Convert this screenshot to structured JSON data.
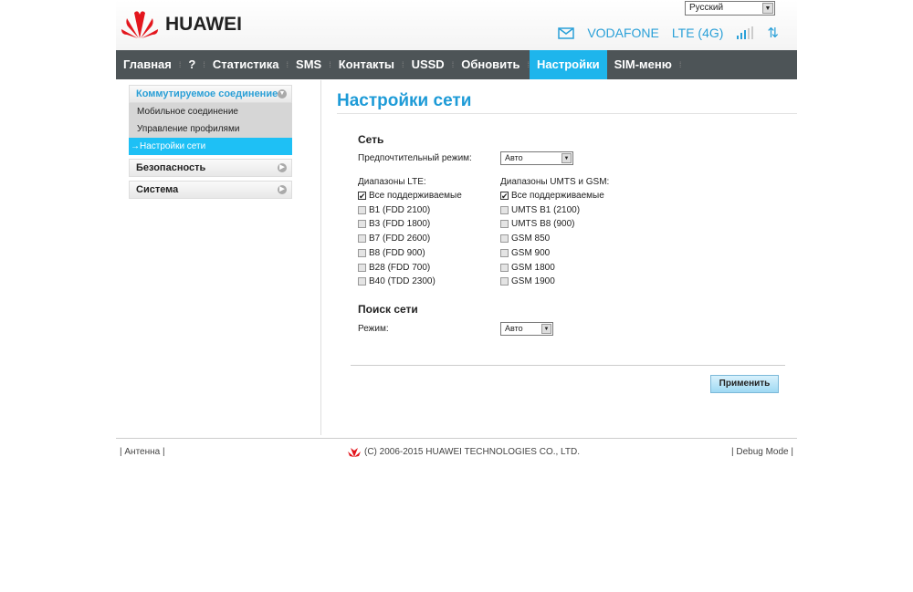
{
  "header": {
    "brand": "HUAWEI",
    "language": "Русский",
    "operator": "VODAFONE",
    "network": "LTE (4G)"
  },
  "nav": [
    {
      "label": "Главная"
    },
    {
      "label": "?"
    },
    {
      "label": "Статистика"
    },
    {
      "label": "SMS"
    },
    {
      "label": "Контакты"
    },
    {
      "label": "USSD"
    },
    {
      "label": "Обновить"
    },
    {
      "label": "Настройки",
      "active": true
    },
    {
      "label": "SIM-меню"
    }
  ],
  "sidebar": {
    "group1": "Коммутируемое соединение",
    "items": [
      "Мобильное соединение",
      "Управление профилями",
      "→Настройки сети"
    ],
    "group2": "Безопасность",
    "group3": "Система"
  },
  "main": {
    "title": "Настройки сети",
    "net_heading": "Сеть",
    "pref_label": "Предпочтительный режим:",
    "pref_value": "Авто",
    "lte_label": "Диапазоны LTE:",
    "gsm_label": "Диапазоны UMTS и GSM:",
    "lte": [
      {
        "label": "Все поддерживаемые",
        "checked": true
      },
      {
        "label": "B1 (FDD 2100)"
      },
      {
        "label": "B3 (FDD 1800)"
      },
      {
        "label": "B7 (FDD 2600)"
      },
      {
        "label": "B8 (FDD 900)"
      },
      {
        "label": "B28 (FDD 700)"
      },
      {
        "label": "B40 (TDD 2300)"
      }
    ],
    "gsm": [
      {
        "label": "Все поддерживаемые",
        "checked": true
      },
      {
        "label": "UMTS B1 (2100)"
      },
      {
        "label": "UMTS B8 (900)"
      },
      {
        "label": "GSM 850"
      },
      {
        "label": "GSM 900"
      },
      {
        "label": "GSM 1800"
      },
      {
        "label": "GSM 1900"
      }
    ],
    "search_heading": "Поиск сети",
    "mode_label": "Режим:",
    "mode_value": "Авто",
    "apply": "Применить"
  },
  "footer": {
    "left": "Антенна",
    "copyright": "(C) 2006-2015 HUAWEI TECHNOLOGIES CO., LTD.",
    "right": "Debug Mode"
  },
  "colors": {
    "accent": "#1eb5ec",
    "nav": "#4d5457",
    "title": "#1e9bd7"
  }
}
